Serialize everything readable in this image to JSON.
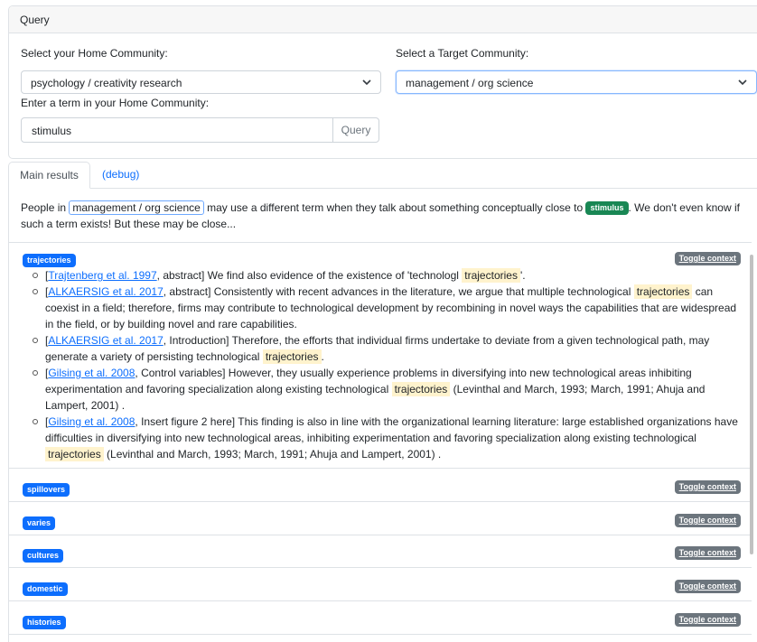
{
  "query": {
    "header": "Query",
    "home_label": "Select your Home Community:",
    "home_value": "psychology / creativity research",
    "target_label": "Select a Target Community:",
    "target_value": "management / org science",
    "term_label": "Enter a term in your Home Community:",
    "term_value": "stimulus",
    "button": "Query"
  },
  "tabs": {
    "main": "Main results",
    "debug": "(debug)"
  },
  "intro": {
    "p1": "People in ",
    "community": "management / org science",
    "p2": " may use a different term when they talk about something conceptually close to ",
    "term": "stimulus",
    "p3": ". We don't even know if such a term exists! But these may be close..."
  },
  "toggle_label": "Toggle context",
  "results": [
    {
      "term": "trajectories"
    },
    {
      "term": "spillovers"
    },
    {
      "term": "varies"
    },
    {
      "term": "cultures"
    },
    {
      "term": "domestic"
    },
    {
      "term": "histories"
    }
  ],
  "contexts": [
    {
      "ref": "Trajtenberg et al. 1997",
      "pre": ", abstract] We find also evidence of the existence of 'technologl ",
      "hl": "trajectories",
      "post": "'."
    },
    {
      "ref": "ALKAERSIG et al. 2017",
      "pre": ", abstract] Consistently with recent advances in the literature, we argue that multiple technological ",
      "hl": "trajectories",
      "post": " can coexist in a field; therefore, firms may contribute to technological development by recombining in novel ways the capabilities that are widespread in the field, or by building novel and rare capabilities."
    },
    {
      "ref": "ALKAERSIG et al. 2017",
      "pre": ", Introduction] Therefore, the efforts that individual firms undertake to deviate from a given technological path, may generate a variety of persisting technological ",
      "hl": "trajectories",
      "post": "."
    },
    {
      "ref": "Gilsing et al. 2008",
      "pre": ", Control variables] However, they usually experience problems in diversifying into new technological areas inhibiting experimentation and favoring specialization along existing technological ",
      "hl": "trajectories",
      "post": " (Levinthal and March, 1993; March, 1991; Ahuja and Lampert, 2001) ."
    },
    {
      "ref": "Gilsing et al. 2008",
      "pre": ", Insert figure 2 here] This finding is also in line with the organizational learning literature: large established organizations have difficulties in diversifying into new technological areas, inhibiting experimentation and favoring specialization along existing technological ",
      "hl": "trajectories",
      "post": " (Levinthal and March, 1993; March, 1991; Ahuja and Lampert, 2001) ."
    }
  ]
}
